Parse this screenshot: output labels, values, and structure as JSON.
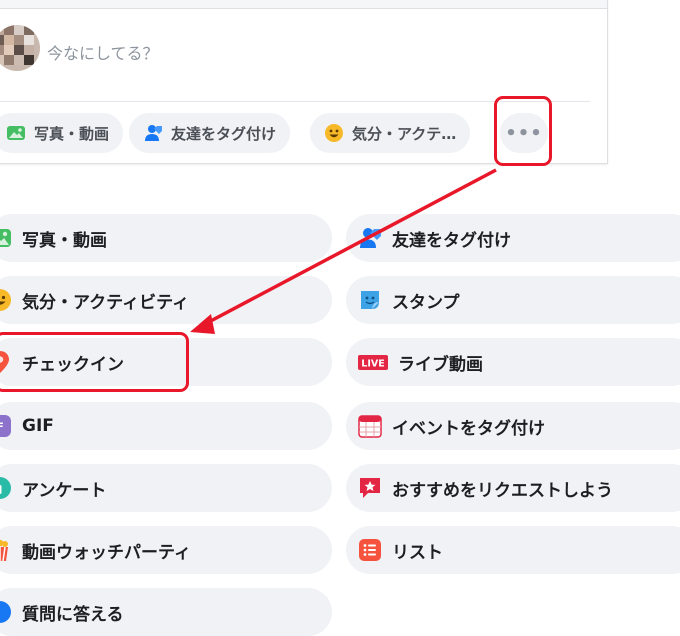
{
  "composer": {
    "prompt": "今なにしてる？",
    "chips": [
      {
        "label": "写真・動画",
        "icon": "photo-icon"
      },
      {
        "label": "友達をタグ付け",
        "icon": "tag-friends-icon"
      },
      {
        "label": "気分・アクテ…",
        "icon": "feeling-icon"
      }
    ],
    "more_label": "•••"
  },
  "options": {
    "left": [
      {
        "label": "写真・動画",
        "icon": "photo-icon"
      },
      {
        "label": "気分・アクティビティ",
        "icon": "feeling-icon"
      },
      {
        "label": "チェックイン",
        "icon": "checkin-pin-icon"
      },
      {
        "label": "GIF",
        "icon": "gif-icon"
      },
      {
        "label": "アンケート",
        "icon": "poll-icon"
      },
      {
        "label": "動画ウォッチパーティ",
        "icon": "watch-party-icon"
      },
      {
        "label": "質問に答える",
        "icon": "question-icon"
      }
    ],
    "right": [
      {
        "label": "友達をタグ付け",
        "icon": "tag-friends-icon"
      },
      {
        "label": "スタンプ",
        "icon": "sticker-icon"
      },
      {
        "label": "ライブ動画",
        "icon": "live-video-icon",
        "badge": "LIVE"
      },
      {
        "label": "イベントをタグ付け",
        "icon": "calendar-icon"
      },
      {
        "label": "おすすめをリクエストしよう",
        "icon": "recommendation-icon"
      },
      {
        "label": "リスト",
        "icon": "list-icon"
      }
    ]
  },
  "colors": {
    "highlight": "#e8182a",
    "chip_bg": "#f0f2f5",
    "photo_green": "#45bd62",
    "tag_blue": "#1877f2",
    "feeling_yellow": "#f7b928",
    "checkin_red": "#f5533d",
    "gif_purple": "#8c72cb",
    "poll_green": "#2abba7",
    "list_orange": "#f5533d"
  }
}
